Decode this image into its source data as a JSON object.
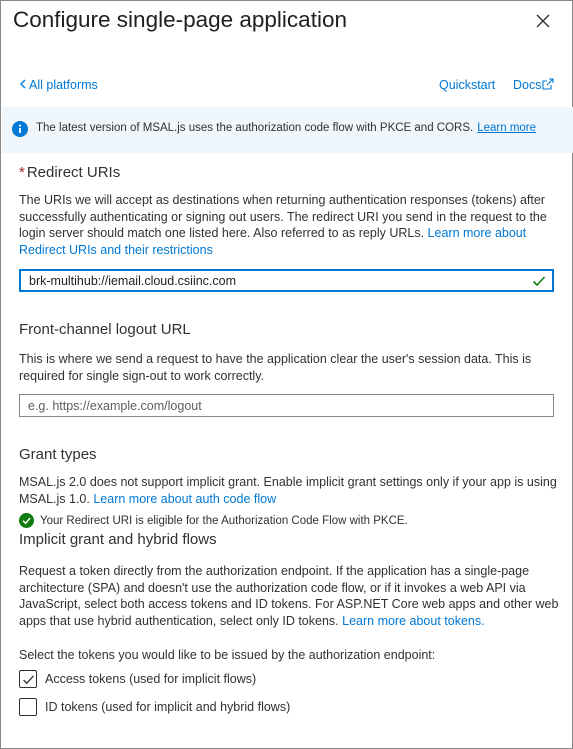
{
  "panel": {
    "title": "Configure single-page application",
    "close_icon": "close-icon"
  },
  "nav": {
    "back_label": "All platforms",
    "quickstart_label": "Quickstart",
    "docs_label": "Docs"
  },
  "banner": {
    "message": "The latest version of MSAL.js uses the authorization code flow with PKCE and CORS.",
    "link": "Learn more"
  },
  "redirect": {
    "required_mark": "*",
    "heading": "Redirect URIs",
    "description": "The URIs we will accept as destinations when returning authentication responses (tokens) after successfully authenticating or signing out users. The redirect URI you send in the request to the login server should match one listed here. Also referred to as reply URLs.",
    "link": "Learn more about Redirect URIs and their restrictions",
    "value": "brk-multihub://iemail.cloud.csiinc.com"
  },
  "logout": {
    "heading": "Front-channel logout URL",
    "description": "This is where we send a request to have the application clear the user's session data. This is required for single sign-out to work correctly.",
    "placeholder": "e.g. https://example.com/logout",
    "value": ""
  },
  "grant": {
    "heading": "Grant types",
    "description": "MSAL.js 2.0 does not support implicit grant. Enable implicit grant settings only if your app is using MSAL.js 1.0.",
    "link": "Learn more about auth code flow",
    "eligible_message": "Your Redirect URI is eligible for the Authorization Code Flow with PKCE."
  },
  "implicit": {
    "heading": "Implicit grant and hybrid flows",
    "description": "Request a token directly from the authorization endpoint. If the application has a single-page architecture (SPA) and doesn't use the authorization code flow, or if it invokes a web API via JavaScript, select both access tokens and ID tokens. For ASP.NET Core web apps and other web apps that use hybrid authentication, select only ID tokens.",
    "link": "Learn more about tokens.",
    "select_prompt": "Select the tokens you would like to be issued by the authorization endpoint:",
    "options": [
      {
        "label": "Access tokens (used for implicit flows)",
        "checked": true
      },
      {
        "label": "ID tokens (used for implicit and hybrid flows)",
        "checked": false
      }
    ]
  },
  "colors": {
    "link": "#0078d4",
    "success": "#107c10",
    "required": "#a4262c",
    "banner_bg": "#eff6fc"
  }
}
